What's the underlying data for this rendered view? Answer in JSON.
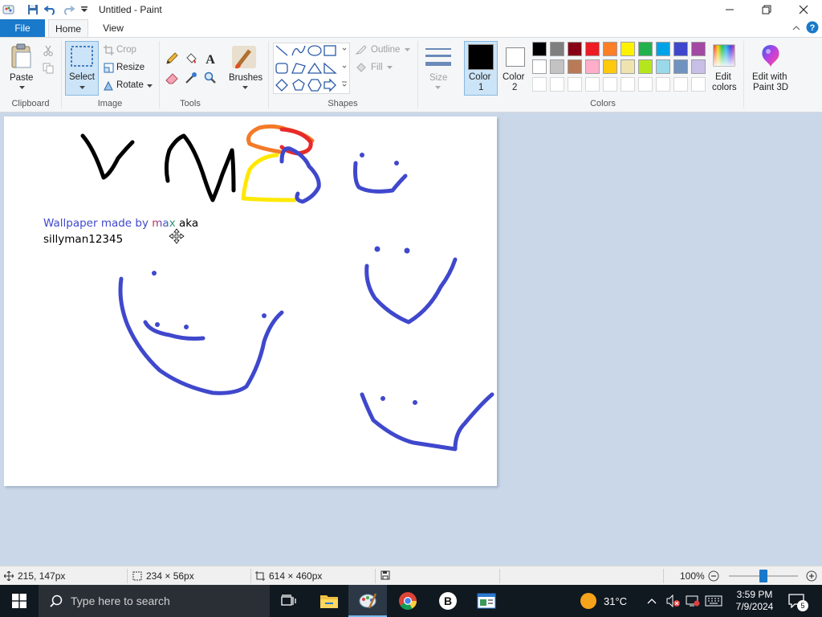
{
  "window": {
    "title": "Untitled - Paint",
    "quick_access": [
      "paint-app-icon",
      "save-icon",
      "undo-icon",
      "redo-icon",
      "customize-qat-icon"
    ],
    "controls": [
      "minimize-icon",
      "maximize-icon",
      "close-icon"
    ]
  },
  "tabs": {
    "file": "File",
    "home": "Home",
    "view": "View"
  },
  "ribbon": {
    "clipboard": {
      "label": "Clipboard",
      "paste": "Paste"
    },
    "image": {
      "label": "Image",
      "select": "Select",
      "crop": "Crop",
      "resize": "Resize",
      "rotate": "Rotate"
    },
    "tools": {
      "label": "Tools"
    },
    "brushes": {
      "label": "Brushes"
    },
    "shapes": {
      "label": "Shapes",
      "outline": "Outline",
      "fill": "Fill"
    },
    "size": {
      "label": "Size"
    },
    "colors": {
      "label": "Colors",
      "color1": "Color",
      "color1_num": "1",
      "color2": "Color",
      "color2_num": "2",
      "edit_colors_1": "Edit",
      "edit_colors_2": "colors",
      "color1_value": "#000000",
      "color2_value": "#ffffff",
      "palette_row1": [
        "#000000",
        "#7f7f7f",
        "#880015",
        "#ed1c24",
        "#ff7f27",
        "#fff200",
        "#22b14c",
        "#00a2e8",
        "#3f48cc",
        "#a349a4"
      ],
      "palette_row2": [
        "#ffffff",
        "#c3c3c3",
        "#b97a57",
        "#ffaec9",
        "#ffc90e",
        "#efe4b0",
        "#b5e61d",
        "#99d9ea",
        "#7092be",
        "#c8bfe7"
      ]
    },
    "paint3d": {
      "line1": "Edit with",
      "line2": "Paint 3D"
    }
  },
  "canvas": {
    "text_line1_part1": "Wallpaper made by ",
    "text_line1_part2": "max",
    "text_line1_part3": " aka",
    "text_line2": "sillyman12345"
  },
  "status": {
    "cursor_pos": "215, 147px",
    "selection_size": "234 × 56px",
    "image_size": "614 × 460px",
    "zoom": "100%",
    "zoom_level": 0.5
  },
  "taskbar": {
    "search_placeholder": "Type here to search",
    "temperature": "31°C",
    "time": "3:59 PM",
    "date": "7/9/2024",
    "notifications": "5"
  }
}
